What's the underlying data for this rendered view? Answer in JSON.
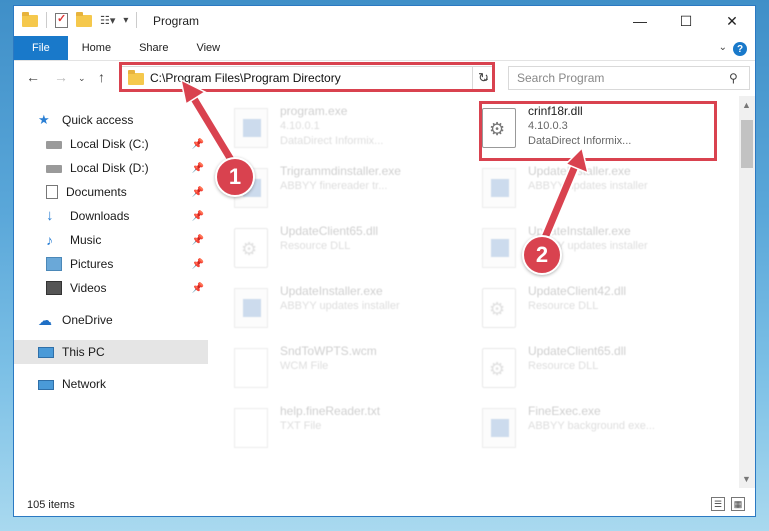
{
  "window": {
    "title": "Program",
    "minimize_icon": "minimize-icon",
    "maximize_icon": "maximize-icon",
    "close_icon": "close-icon"
  },
  "ribbon": {
    "tabs": [
      "File",
      "Home",
      "Share",
      "View"
    ],
    "help": "?"
  },
  "address": {
    "path": "C:\\Program Files\\Program Directory",
    "refresh_icon": "refresh-icon"
  },
  "search": {
    "placeholder": "Search Program"
  },
  "nav": {
    "items": [
      {
        "label": "Quick access",
        "icon": "star-icon",
        "pinned": false
      },
      {
        "label": "Local Disk (C:)",
        "icon": "drive-icon",
        "pinned": true
      },
      {
        "label": "Local Disk (D:)",
        "icon": "drive-icon",
        "pinned": true
      },
      {
        "label": "Documents",
        "icon": "documents-icon",
        "pinned": true
      },
      {
        "label": "Downloads",
        "icon": "downloads-icon",
        "pinned": true
      },
      {
        "label": "Music",
        "icon": "music-icon",
        "pinned": true
      },
      {
        "label": "Pictures",
        "icon": "pictures-icon",
        "pinned": true
      },
      {
        "label": "Videos",
        "icon": "videos-icon",
        "pinned": true
      },
      {
        "label": "OneDrive",
        "icon": "cloud-icon",
        "pinned": false
      },
      {
        "label": "This PC",
        "icon": "computer-icon",
        "pinned": false,
        "selected": true
      },
      {
        "label": "Network",
        "icon": "network-icon",
        "pinned": false
      }
    ]
  },
  "files": [
    {
      "name": "program.exe",
      "line1": "4.10.0.1",
      "line2": "DataDirect Informix...",
      "icon": "exe",
      "faded": true
    },
    {
      "name": "crinf18r.dll",
      "line1": "4.10.0.3",
      "line2": "DataDirect Informix...",
      "icon": "dll",
      "faded": false
    },
    {
      "name": "Trigrammdinstaller.exe",
      "line1": "ABBYY finereader tr...",
      "line2": "",
      "icon": "exe",
      "faded": true
    },
    {
      "name": "UpdateInstaller.exe",
      "line1": "ABBYY updates installer",
      "line2": "",
      "icon": "exe",
      "faded": true
    },
    {
      "name": "UpdateClient65.dll",
      "line1": "Resource DLL",
      "line2": "",
      "icon": "dll",
      "faded": true
    },
    {
      "name": "UpdateInstaller.exe",
      "line1": "ABBYY updates installer",
      "line2": "",
      "icon": "exe",
      "faded": true
    },
    {
      "name": "UpdateInstaller.exe",
      "line1": "ABBYY updates installer",
      "line2": "",
      "icon": "exe",
      "faded": true
    },
    {
      "name": "UpdateClient42.dll",
      "line1": "Resource DLL",
      "line2": "",
      "icon": "dll",
      "faded": true
    },
    {
      "name": "SndToWPTS.wcm",
      "line1": "WCM File",
      "line2": "",
      "icon": "doc",
      "faded": true
    },
    {
      "name": "UpdateClient65.dll",
      "line1": "Resource DLL",
      "line2": "",
      "icon": "dll",
      "faded": true
    },
    {
      "name": "help.fineReader.txt",
      "line1": "TXT File",
      "line2": "",
      "icon": "doc",
      "faded": true
    },
    {
      "name": "FineExec.exe",
      "line1": "ABBYY background exe...",
      "line2": "",
      "icon": "exe",
      "faded": true
    }
  ],
  "status": {
    "count": "105 items"
  },
  "annotations": {
    "badge1": "1",
    "badge2": "2",
    "highlight_color": "#d9424f"
  }
}
